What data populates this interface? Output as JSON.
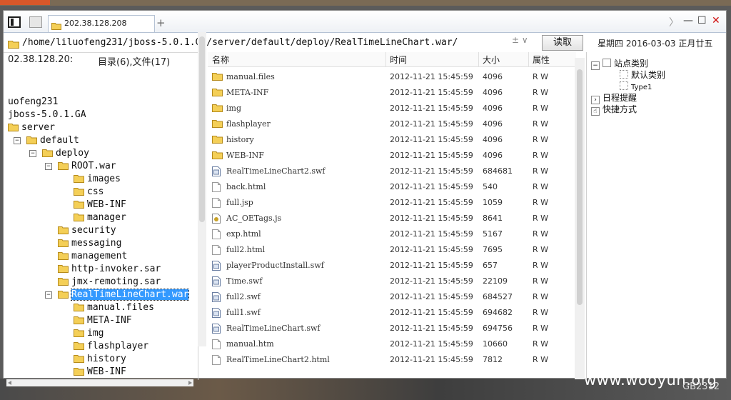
{
  "tab": {
    "title": "202.38.128.208",
    "new_tab": "+"
  },
  "window_controls": {
    "forward": "〉",
    "minimize": "—",
    "maximize": "☐",
    "close": "✕"
  },
  "address": {
    "path": "/home/liluofeng231/jboss-5.0.1.GA/server/default/deploy/RealTimeLineChart.war/",
    "drop": "± ∨",
    "read_label": "读取"
  },
  "date_text": "星期四 2016-03-03 正月廿五",
  "left_panel": {
    "host": "02.38.128.20:",
    "counts": "目录(6),文件(17)",
    "tree": [
      {
        "label": "uofeng231",
        "level": 0,
        "icon": false,
        "exp": ""
      },
      {
        "label": "jboss-5.0.1.GA",
        "level": 0,
        "icon": false,
        "exp": ""
      },
      {
        "label": "server",
        "level": 0,
        "icon": true,
        "exp": ""
      },
      {
        "label": "default",
        "level": 1,
        "icon": true,
        "exp": "−"
      },
      {
        "label": "deploy",
        "level": 2,
        "icon": true,
        "exp": "−"
      },
      {
        "label": "ROOT.war",
        "level": 3,
        "icon": true,
        "exp": "−"
      },
      {
        "label": "images",
        "level": 4,
        "icon": true,
        "exp": ""
      },
      {
        "label": "css",
        "level": 4,
        "icon": true,
        "exp": ""
      },
      {
        "label": "WEB-INF",
        "level": 4,
        "icon": true,
        "exp": ""
      },
      {
        "label": "manager",
        "level": 4,
        "icon": true,
        "exp": ""
      },
      {
        "label": "security",
        "level": 3,
        "icon": true,
        "exp": ""
      },
      {
        "label": "messaging",
        "level": 3,
        "icon": true,
        "exp": ""
      },
      {
        "label": "management",
        "level": 3,
        "icon": true,
        "exp": ""
      },
      {
        "label": "http-invoker.sar",
        "level": 3,
        "icon": true,
        "exp": ""
      },
      {
        "label": "jmx-remoting.sar",
        "level": 3,
        "icon": true,
        "exp": ""
      },
      {
        "label": "RealTimeLineChart.war",
        "level": 3,
        "icon": true,
        "exp": "−",
        "selected": true
      },
      {
        "label": "manual.files",
        "level": 4,
        "icon": true,
        "exp": ""
      },
      {
        "label": "META-INF",
        "level": 4,
        "icon": true,
        "exp": ""
      },
      {
        "label": "img",
        "level": 4,
        "icon": true,
        "exp": ""
      },
      {
        "label": "flashplayer",
        "level": 4,
        "icon": true,
        "exp": ""
      },
      {
        "label": "history",
        "level": 4,
        "icon": true,
        "exp": ""
      },
      {
        "label": "WEB-INF",
        "level": 4,
        "icon": true,
        "exp": ""
      }
    ]
  },
  "file_list": {
    "headers": {
      "name": "名称",
      "time": "时间",
      "size": "大小",
      "attr": "属性"
    },
    "rows": [
      {
        "name": "manual.files",
        "time": "2012-11-21 15:45:59",
        "size": "4096",
        "attr": "R W",
        "type": "folder"
      },
      {
        "name": "META-INF",
        "time": "2012-11-21 15:45:59",
        "size": "4096",
        "attr": "R W",
        "type": "folder"
      },
      {
        "name": "img",
        "time": "2012-11-21 15:45:59",
        "size": "4096",
        "attr": "R W",
        "type": "folder"
      },
      {
        "name": "flashplayer",
        "time": "2012-11-21 15:45:59",
        "size": "4096",
        "attr": "R W",
        "type": "folder"
      },
      {
        "name": "history",
        "time": "2012-11-21 15:45:59",
        "size": "4096",
        "attr": "R W",
        "type": "folder"
      },
      {
        "name": "WEB-INF",
        "time": "2012-11-21 15:45:59",
        "size": "4096",
        "attr": "R W",
        "type": "folder"
      },
      {
        "name": "RealTimeLineChart2.swf",
        "time": "2012-11-21 15:45:59",
        "size": "684681",
        "attr": "R W",
        "type": "swf"
      },
      {
        "name": "back.html",
        "time": "2012-11-21 15:45:59",
        "size": "540",
        "attr": "R W",
        "type": "file"
      },
      {
        "name": "full.jsp",
        "time": "2012-11-21 15:45:59",
        "size": "1059",
        "attr": "R W",
        "type": "file"
      },
      {
        "name": "AC_OETags.js",
        "time": "2012-11-21 15:45:59",
        "size": "8641",
        "attr": "R W",
        "type": "script"
      },
      {
        "name": "exp.html",
        "time": "2012-11-21 15:45:59",
        "size": "5167",
        "attr": "R W",
        "type": "file"
      },
      {
        "name": "full2.html",
        "time": "2012-11-21 15:45:59",
        "size": "7695",
        "attr": "R W",
        "type": "file"
      },
      {
        "name": "playerProductInstall.swf",
        "time": "2012-11-21 15:45:59",
        "size": "657",
        "attr": "R W",
        "type": "swf"
      },
      {
        "name": "Time.swf",
        "time": "2012-11-21 15:45:59",
        "size": "22109",
        "attr": "R W",
        "type": "swf"
      },
      {
        "name": "full2.swf",
        "time": "2012-11-21 15:45:59",
        "size": "684527",
        "attr": "R W",
        "type": "swf"
      },
      {
        "name": "full1.swf",
        "time": "2012-11-21 15:45:59",
        "size": "694682",
        "attr": "R W",
        "type": "swf"
      },
      {
        "name": "RealTimeLineChart.swf",
        "time": "2012-11-21 15:45:59",
        "size": "694756",
        "attr": "R W",
        "type": "swf"
      },
      {
        "name": "manual.htm",
        "time": "2012-11-21 15:45:59",
        "size": "10660",
        "attr": "R W",
        "type": "file"
      },
      {
        "name": "RealTimeLineChart2.html",
        "time": "2012-11-21 15:45:59",
        "size": "7812",
        "attr": "R W",
        "type": "file"
      }
    ]
  },
  "side_panel": {
    "items": [
      {
        "label": "站点类别",
        "level": 0,
        "box": "−"
      },
      {
        "label": "默认类别",
        "level": 1,
        "box": ""
      },
      {
        "label": "Type1",
        "level": 1,
        "box": ""
      },
      {
        "label": "日程提醒",
        "level": 0,
        "box": "›"
      },
      {
        "label": "快捷方式",
        "level": 0,
        "box": "☝"
      }
    ]
  },
  "watermark": "www.wooyun.org",
  "encoding": "GB2312"
}
